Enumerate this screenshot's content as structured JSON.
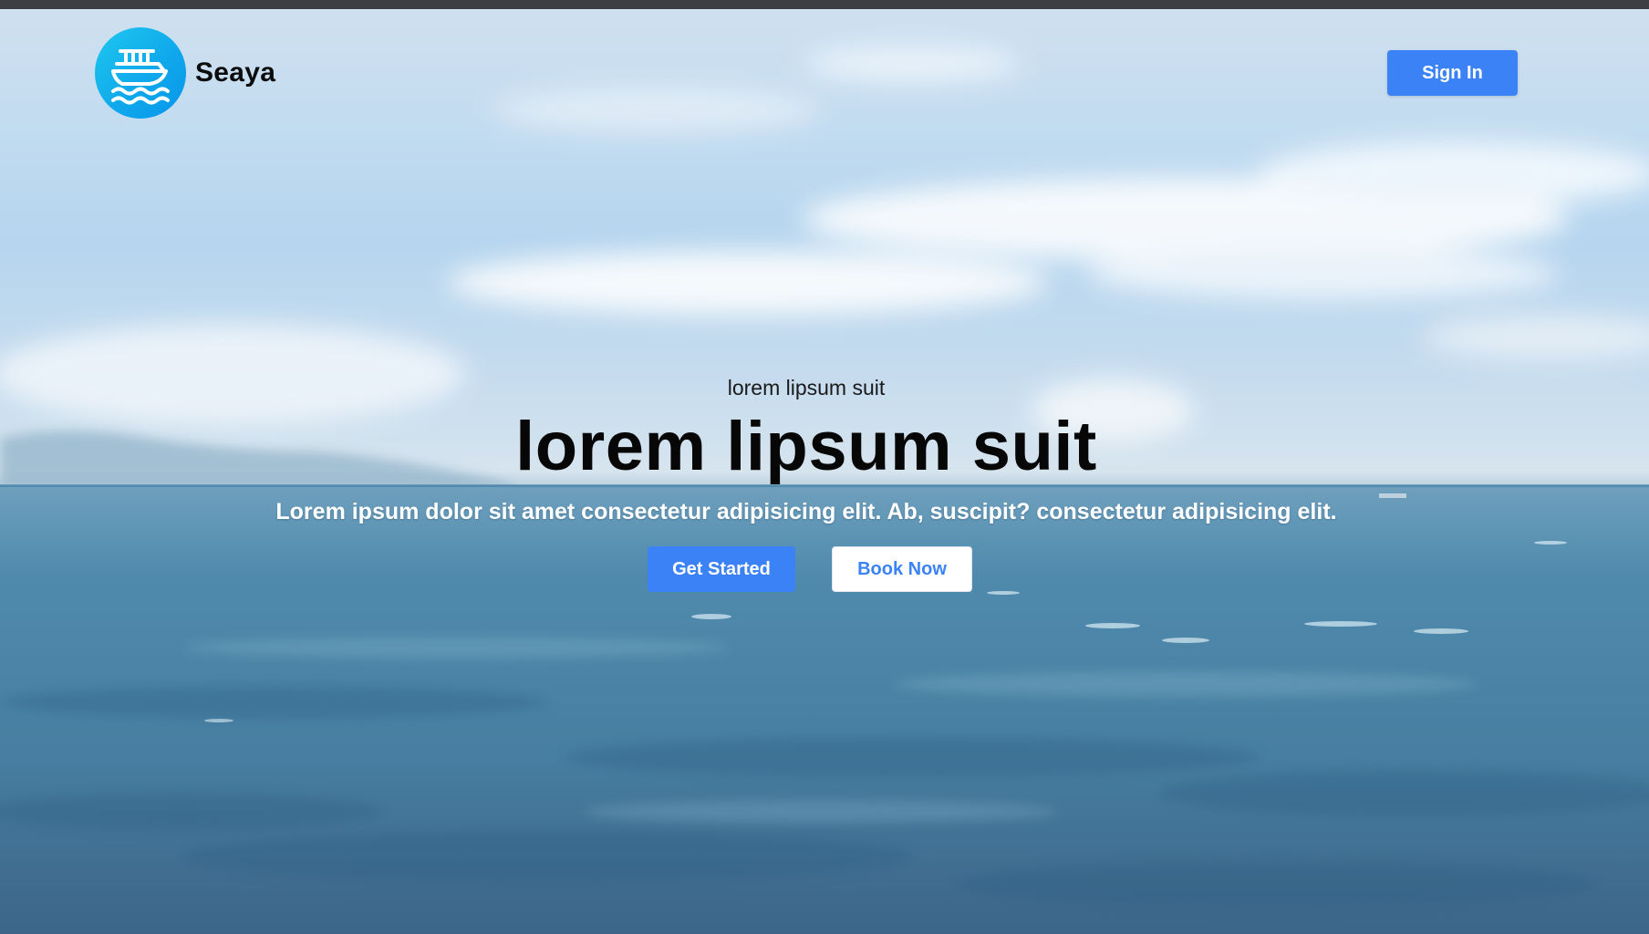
{
  "header": {
    "brand_name": "Seaya",
    "logo_icon": "ship-on-waves-icon",
    "sign_in_label": "Sign In"
  },
  "hero": {
    "kicker": "lorem lipsum suit",
    "headline": "lorem lipsum suit",
    "tagline": "Lorem ipsum dolor sit amet consectetur adipisicing elit. Ab, suscipit? consectetur adipisicing elit.",
    "primary_button_label": "Get Started",
    "secondary_button_label": "Book Now",
    "background": "ocean-sky-video"
  },
  "colors": {
    "accent": "#3b82f6",
    "logo_gradient_start": "#1ec8ef",
    "logo_gradient_end": "#0795ea"
  }
}
